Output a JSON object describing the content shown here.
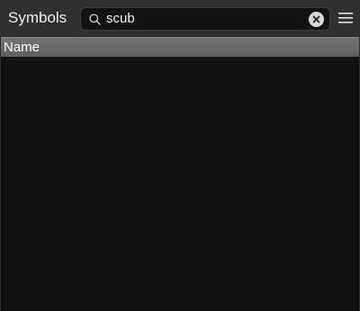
{
  "header": {
    "title": "Symbols"
  },
  "search": {
    "value": "scub",
    "icon": "search-icon",
    "clear_icon": "clear-icon"
  },
  "menu": {
    "icon": "hamburger-menu-icon"
  },
  "table": {
    "columns": [
      "Name"
    ],
    "rows": []
  },
  "colors": {
    "header_bg": "#2f3031",
    "panel_bg": "#111212",
    "column_header_bg": "#686a6a",
    "text": "#eeeeee"
  }
}
